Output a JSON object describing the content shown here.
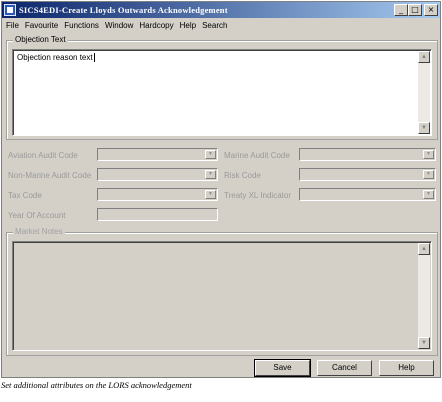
{
  "window": {
    "title": "SICS4EDI-Create Lloyds Outwards Acknowledgement",
    "buttons": {
      "minimize": "_",
      "maximize": "□",
      "close": "×"
    }
  },
  "menu": [
    "File",
    "Favourite",
    "Functions",
    "Window",
    "Hardcopy",
    "Help",
    "Search"
  ],
  "objection": {
    "label": "Objection Text",
    "value": "Objection reason text"
  },
  "fields": {
    "aviation_audit_code": {
      "label": "Aviation Audit Code",
      "value": ""
    },
    "marine_audit_code": {
      "label": "Marine Audit Code",
      "value": ""
    },
    "non_marine_audit_code": {
      "label": "Non-Marine Audit Code",
      "value": ""
    },
    "risk_code": {
      "label": "Risk Code",
      "value": ""
    },
    "tax_code": {
      "label": "Tax Code",
      "value": ""
    },
    "treaty_xl_indicator": {
      "label": "Treaty XL Indicator",
      "value": ""
    },
    "year_of_account": {
      "label": "Year Of Account",
      "value": ""
    }
  },
  "market_notes": {
    "label": "Market Notes",
    "value": ""
  },
  "actions": {
    "save": "Save",
    "cancel": "Cancel",
    "help": "Help"
  },
  "caption": "Set additional attributes on the LORS acknowledgement",
  "icons": {
    "scroll_up": "▲",
    "scroll_down": "▼",
    "dropdown": "▼"
  },
  "colors": {
    "title_start": "#0a246a",
    "title_end": "#a6caf0",
    "face": "#d4d0c8"
  }
}
